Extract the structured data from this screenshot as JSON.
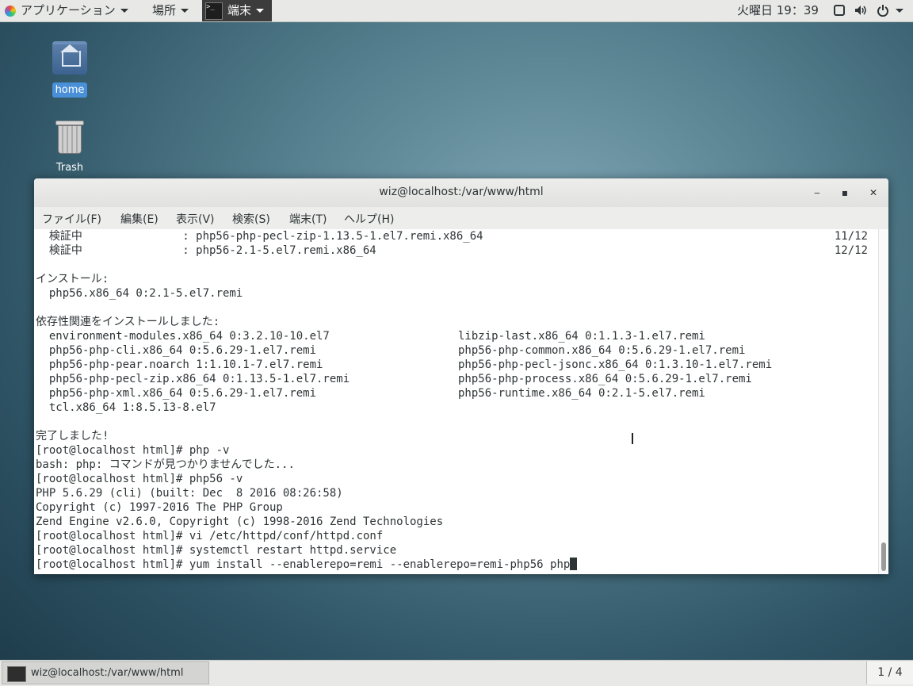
{
  "topbar": {
    "applications": "アプリケーション",
    "places": "場所",
    "terminal": "端末",
    "clock": "火曜日 19：39",
    "icons": [
      "screen-icon",
      "volume-icon",
      "power-icon"
    ]
  },
  "desktop": {
    "home": "home",
    "trash": "Trash"
  },
  "window": {
    "title": "wiz@localhost:/var/www/html",
    "controls": [
      "minimize",
      "maximize",
      "close"
    ],
    "menu": [
      "ファイル(F)",
      "編集(E)",
      "表示(V)",
      "検索(S)",
      "端末(T)",
      "ヘルプ(H)"
    ]
  },
  "terminal": {
    "lines": [
      {
        "l": "  検証中               : php56-php-pecl-zip-1.13.5-1.el7.remi.x86_64",
        "r": "11/12"
      },
      {
        "l": "  検証中               : php56-2.1-5.el7.remi.x86_64",
        "r": "12/12"
      },
      {
        "l": ""
      },
      {
        "l": "インストール:"
      },
      {
        "l": "  php56.x86_64 0:2.1-5.el7.remi"
      },
      {
        "l": ""
      },
      {
        "l": "依存性関連をインストールしました:"
      },
      {
        "l": "  environment-modules.x86_64 0:3.2.10-10.el7",
        "c": "libzip-last.x86_64 0:1.1.3-1.el7.remi"
      },
      {
        "l": "  php56-php-cli.x86_64 0:5.6.29-1.el7.remi",
        "c": "php56-php-common.x86_64 0:5.6.29-1.el7.remi"
      },
      {
        "l": "  php56-php-pear.noarch 1:1.10.1-7.el7.remi",
        "c": "php56-php-pecl-jsonc.x86_64 0:1.3.10-1.el7.remi"
      },
      {
        "l": "  php56-php-pecl-zip.x86_64 0:1.13.5-1.el7.remi",
        "c": "php56-php-process.x86_64 0:5.6.29-1.el7.remi"
      },
      {
        "l": "  php56-php-xml.x86_64 0:5.6.29-1.el7.remi",
        "c": "php56-runtime.x86_64 0:2.1-5.el7.remi"
      },
      {
        "l": "  tcl.x86_64 1:8.5.13-8.el7"
      },
      {
        "l": ""
      },
      {
        "l": "完了しました!"
      },
      {
        "l": "[root@localhost html]# php -v"
      },
      {
        "l": "bash: php: コマンドが見つかりませんでした..."
      },
      {
        "l": "[root@localhost html]# php56 -v"
      },
      {
        "l": "PHP 5.6.29 (cli) (built: Dec  8 2016 08:26:58)"
      },
      {
        "l": "Copyright (c) 1997-2016 The PHP Group"
      },
      {
        "l": "Zend Engine v2.6.0, Copyright (c) 1998-2016 Zend Technologies"
      },
      {
        "l": "[root@localhost html]# vi /etc/httpd/conf/httpd.conf"
      },
      {
        "l": "[root@localhost html]# systemctl restart httpd.service"
      }
    ],
    "prompt_line": "[root@localhost html]# yum install --enablerepo=remi --enablerepo=remi-php56 php"
  },
  "bottombar": {
    "task": "wiz@localhost:/var/www/html",
    "workspace": "1 / 4"
  }
}
